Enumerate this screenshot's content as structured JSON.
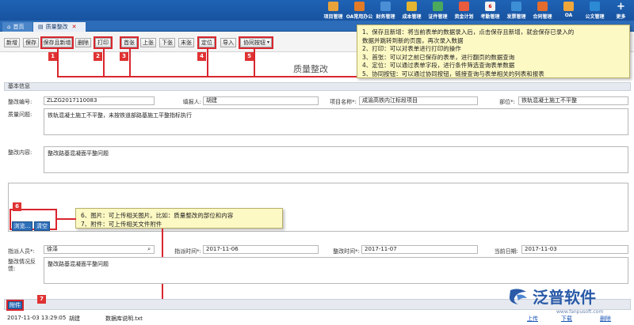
{
  "topnav": [
    {
      "label": "项目管理",
      "icon": "chart-icon",
      "color": "#e7a23a"
    },
    {
      "label": "OA常用办公",
      "icon": "oa-icon",
      "color": "#e37b26"
    },
    {
      "label": "财务管理",
      "icon": "finance-icon",
      "color": "#4a8fd6"
    },
    {
      "label": "成本管理",
      "icon": "cost-icon",
      "color": "#e4b530"
    },
    {
      "label": "证件管理",
      "icon": "certificate-icon",
      "color": "#4aa95c"
    },
    {
      "label": "资金计划",
      "icon": "fund-icon",
      "color": "#e85b3c"
    },
    {
      "label": "考勤管理",
      "icon": "calendar-icon",
      "color": "#f2f2f2"
    },
    {
      "label": "发票管理",
      "icon": "invoice-icon",
      "color": "#3d8fd5"
    },
    {
      "label": "合同管理",
      "icon": "contract-icon",
      "color": "#e36b2c"
    },
    {
      "label": "OA",
      "icon": "oa-icon",
      "color": "#f0a73a"
    },
    {
      "label": "公文管理",
      "icon": "document-icon",
      "color": "#2c8ad4"
    },
    {
      "label": "更多",
      "icon": "plus-icon",
      "color": "#ffffff"
    }
  ],
  "calendar_day": "6",
  "tabs": {
    "home": "首页",
    "active": "质量整改"
  },
  "toolbar": {
    "add": "新增",
    "save": "保存",
    "save_new": "保存且新增",
    "delete": "删除",
    "print": "打印",
    "first": "首张",
    "prev": "上张",
    "next": "下张",
    "last": "末张",
    "locate": "定位",
    "import": "导入",
    "collab": "协同按钮"
  },
  "page_title": "质量整改",
  "markers": [
    "1",
    "2",
    "3",
    "4",
    "5",
    "6",
    "7"
  ],
  "note_top": [
    "1、保存且新增：将当前表单的数据录入后，点击保存且新增，就会保存已录入的",
    "数据并跳转到新的页面，再次录入数据",
    "2、打印：可以对表单进行打印的操作",
    "3、首张：可以对之前已保存的表单，进行翻页的数据查询",
    "4、定位：可以通过表单字段，进行条件筛选查询表单数据",
    "5、协同按钮：可以通过协同按钮，链接查询与表单相关的列表和报表"
  ],
  "note_mid": [
    "6、图片：可上传相关图片。比如：质量整改的部位和内容",
    "7、附件：可上传相关文件附件"
  ],
  "section": "基本信息",
  "form": {
    "code_label": "整改编号:",
    "code_value": "ZLZG2017110083",
    "reporter_label": "填报人:",
    "reporter_value": "胡建",
    "project_label": "项目名称*:",
    "project_value": "成渝高铁内江标段项目",
    "part_label": "部位*:",
    "part_value": "铁轨混凝土施工不平整",
    "issue_label": "质量问题:",
    "issue_value": "铁轨混凝土施工不平整，未按铁道部路基施工平整指标执行",
    "content_label": "整改内容:",
    "content_value": "整改路基混凝面平整问题",
    "browse": "浏览...",
    "clear": "清空",
    "assignee_label": "指派人员*:",
    "assignee_value": "徐泽",
    "assign_time_label": "指派时间*:",
    "assign_time_value": "2017-11-06",
    "rect_time_label": "整改时间*:",
    "rect_time_value": "2017-11-07",
    "today_label": "当前日期:",
    "today_value": "2017-11-03",
    "status_label": "整改情况反馈:",
    "status_value": "整改路基混凝面平整问题"
  },
  "attachment": {
    "button": "附件",
    "time": "2017-11-03 13:29:05",
    "user": "胡建",
    "file": "数据库说明.txt",
    "upload": "上传",
    "download": "下载",
    "delete": "删除"
  },
  "brand": {
    "name": "泛普软件",
    "url": "www.fanpusoft.com"
  }
}
